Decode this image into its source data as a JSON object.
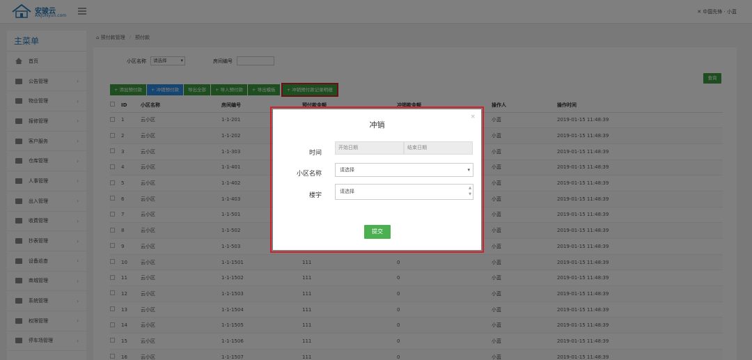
{
  "header": {
    "logo_name": "安骏云",
    "logo_sub": "ANJUNyun.com",
    "right_text": "✕ 中国先锋 · 小蓝"
  },
  "sidebar": {
    "title": "主菜单",
    "items": [
      {
        "label": "首页",
        "icon": "home-icon"
      },
      {
        "label": "公告管理",
        "icon": "folder-icon"
      },
      {
        "label": "物业管理",
        "icon": "folder-icon"
      },
      {
        "label": "报修管理",
        "icon": "folder-icon"
      },
      {
        "label": "客户服务",
        "icon": "folder-icon"
      },
      {
        "label": "仓库管理",
        "icon": "folder-icon"
      },
      {
        "label": "人事管理",
        "icon": "folder-icon"
      },
      {
        "label": "出入管理",
        "icon": "folder-icon"
      },
      {
        "label": "收费管理",
        "icon": "folder-icon"
      },
      {
        "label": "抄表管理",
        "icon": "folder-icon"
      },
      {
        "label": "设备巡查",
        "icon": "folder-icon"
      },
      {
        "label": "商城管理",
        "icon": "folder-icon"
      },
      {
        "label": "系统管理",
        "icon": "folder-icon"
      },
      {
        "label": "权限管理",
        "icon": "folder-icon"
      },
      {
        "label": "停车场管理",
        "icon": "folder-icon"
      }
    ]
  },
  "breadcrumb": {
    "parent": "预付款管理",
    "current": "预付款"
  },
  "filters": {
    "community_label": "小区名称",
    "community_value": "请选择",
    "house_label": "房间编号"
  },
  "query_label": "查询",
  "toolbar": {
    "buttons": [
      "添加预付款",
      "冲销预付款",
      "导出全部",
      "导入预付款",
      "导出模板",
      "冲销预付款记录明细"
    ]
  },
  "table": {
    "headers": [
      "ID",
      "小区名称",
      "房间编号",
      "预付款金额",
      "冲销款金额",
      "操作人",
      "操作时间"
    ],
    "rows": [
      [
        "1",
        "云小区",
        "1-1-201",
        "",
        "",
        "小蓝",
        "2019-01-15 11:48:39"
      ],
      [
        "2",
        "云小区",
        "1-1-202",
        "",
        "",
        "小蓝",
        "2019-01-15 11:48:39"
      ],
      [
        "3",
        "云小区",
        "1-1-303",
        "",
        "",
        "小蓝",
        "2019-01-15 11:48:39"
      ],
      [
        "4",
        "云小区",
        "1-1-401",
        "",
        "",
        "小蓝",
        "2019-01-15 11:48:39"
      ],
      [
        "5",
        "云小区",
        "1-1-402",
        "",
        "",
        "小蓝",
        "2019-01-15 11:48:39"
      ],
      [
        "6",
        "云小区",
        "1-1-403",
        "",
        "",
        "小蓝",
        "2019-01-15 11:48:39"
      ],
      [
        "7",
        "云小区",
        "1-1-501",
        "",
        "",
        "小蓝",
        "2019-01-15 11:48:39"
      ],
      [
        "8",
        "云小区",
        "1-1-502",
        "",
        "",
        "小蓝",
        "2019-01-15 11:48:39"
      ],
      [
        "9",
        "云小区",
        "1-1-503",
        "",
        "",
        "小蓝",
        "2019-01-15 11:48:39"
      ],
      [
        "10",
        "云小区",
        "1-1-1501",
        "111",
        "0",
        "小蓝",
        "2019-01-15 11:48:39"
      ],
      [
        "11",
        "云小区",
        "1-1-1502",
        "111",
        "0",
        "小蓝",
        "2019-01-15 11:48:39"
      ],
      [
        "12",
        "云小区",
        "1-1-1503",
        "111",
        "0",
        "小蓝",
        "2019-01-15 11:48:39"
      ],
      [
        "13",
        "云小区",
        "1-1-1504",
        "111",
        "0",
        "小蓝",
        "2019-01-15 11:48:39"
      ],
      [
        "14",
        "云小区",
        "1-1-1505",
        "111",
        "0",
        "小蓝",
        "2019-01-15 11:48:39"
      ],
      [
        "15",
        "云小区",
        "1-1-1506",
        "111",
        "0",
        "小蓝",
        "2019-01-15 11:48:39"
      ],
      [
        "16",
        "云小区",
        "1-1-1507",
        "111",
        "0",
        "小蓝",
        "2019-01-15 11:48:39"
      ]
    ]
  },
  "modal": {
    "title": "冲销",
    "time_label": "时间",
    "start_placeholder": "开始日期",
    "end_placeholder": "结束日期",
    "community_label": "小区名称",
    "community_value": "请选择",
    "building_label": "楼宇",
    "building_value": "请选择",
    "submit_label": "提交",
    "close": "×"
  },
  "colors": {
    "primary_green": "#3c9b3f",
    "primary_blue": "#2a8be0",
    "highlight_red": "#d0202a",
    "submit_green": "#4caf50"
  }
}
